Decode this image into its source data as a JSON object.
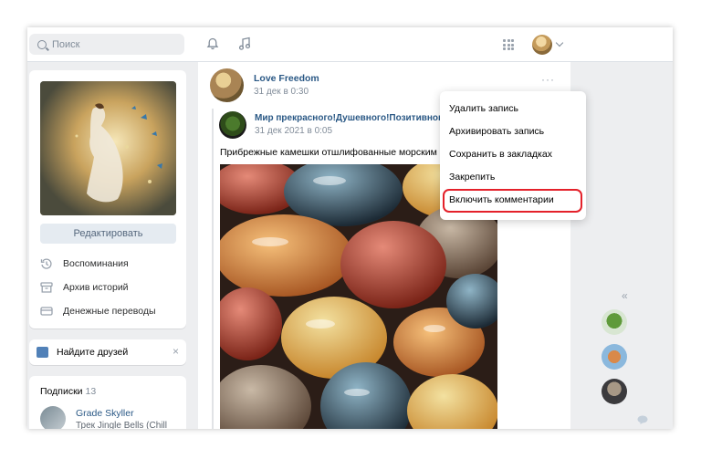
{
  "search": {
    "placeholder": "Поиск"
  },
  "header": {
    "icons": [
      "bell-icon",
      "music-note-icon",
      "apps-grid-icon",
      "chevron-down-icon"
    ]
  },
  "left": {
    "edit_label": "Редактировать",
    "menu": [
      {
        "label": "Воспоминания",
        "icon": "memories-icon"
      },
      {
        "label": "Архив историй",
        "icon": "archive-icon"
      },
      {
        "label": "Денежные переводы",
        "icon": "money-transfer-icon"
      }
    ],
    "find_friends": "Найдите друзей",
    "find_friends_close": "×",
    "subscriptions_title": "Подписки",
    "subscriptions_count": "13",
    "sub_name": "Grade Skyller",
    "sub_track": "Трек Jingle Bells (Chill"
  },
  "post": {
    "author": "Love Freedom",
    "date": "31 дек в 0:30",
    "more": "···",
    "repost_author": "Мир прекрасного!Душевного!Позитивного к",
    "repost_date": "31 дек 2021 в 0:05",
    "text": "Прибрежные камешки отшлифованные морским пр"
  },
  "dropdown": {
    "items": [
      "Удалить запись",
      "Архивировать запись",
      "Сохранить в закладках",
      "Закрепить",
      "Включить комментарии"
    ],
    "highlighted_index": 4,
    "highlight_color": "#e4212a"
  },
  "right": {
    "collapse": "«",
    "chat_badge_icon": "chat-bubble-icon"
  },
  "colors": {
    "link": "#2a5885",
    "accent": "#5181b8",
    "background": "#edeef0"
  }
}
